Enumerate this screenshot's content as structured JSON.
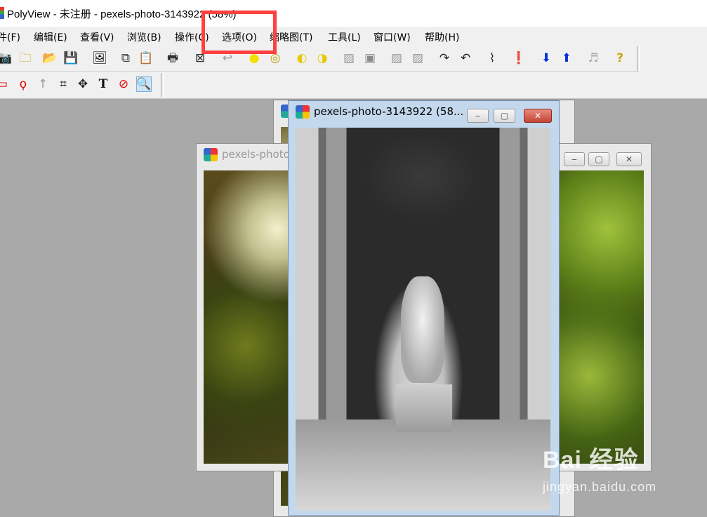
{
  "window": {
    "title": "PolyView - 未注册 - pexels-photo-3143922 (58%)"
  },
  "menu": [
    "件(F)",
    "编辑(E)",
    "查看(V)",
    "浏览(B)",
    "操作(C)",
    "选项(O)",
    "缩略图(T)",
    "工具(L)",
    "窗口(W)",
    "帮助(H)"
  ],
  "toolbar1_icons": [
    "camera-icon",
    "new-folder-icon",
    "open-folder-icon",
    "save-icon",
    "scan-icon",
    "copy-icon",
    "paste-icon",
    "print-icon",
    "select-all-icon",
    "undo-icon",
    "brightness-up-icon",
    "brightness-down-icon",
    "contrast-up-icon",
    "contrast-down-icon",
    "gray-square-icon",
    "black-square-icon",
    "gray-square-2-icon",
    "gray-square-3-icon",
    "rotate-right-icon",
    "rotate-left-icon",
    "waveform-icon",
    "info-icon",
    "arrow-down-icon",
    "arrow-up-icon",
    "music-icon",
    "help-icon"
  ],
  "toolbar2_icons": [
    "rect-select-icon",
    "lasso-icon",
    "pointer-up-icon",
    "crop-icon",
    "move-icon",
    "text-icon",
    "no-sign-icon",
    "zoom-icon"
  ],
  "documents": {
    "left_title": "pexels-photo",
    "front_title": "pexels-photo-3143922 (58...",
    "back_title": ""
  },
  "watermark": {
    "brand": "Bai  经验",
    "url": "jingyan.baidu.com"
  },
  "colors": {
    "highlight": "#ff4040",
    "active_frame": "#c3d8ec"
  }
}
